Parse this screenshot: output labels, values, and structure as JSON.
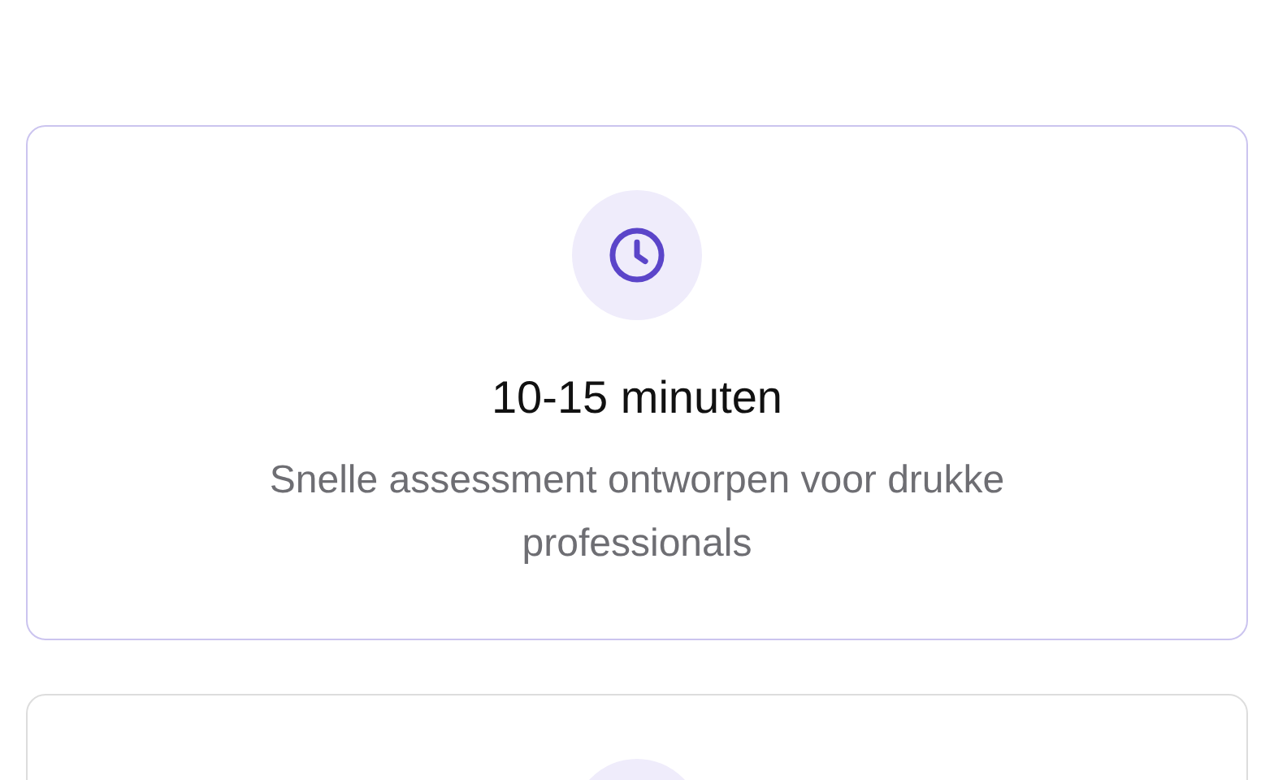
{
  "cards": [
    {
      "kind": "full",
      "title": "10-15 minuten",
      "description": "Snelle assessment ontworpen voor drukke professionals"
    },
    {
      "kind": "clipped"
    }
  ]
}
